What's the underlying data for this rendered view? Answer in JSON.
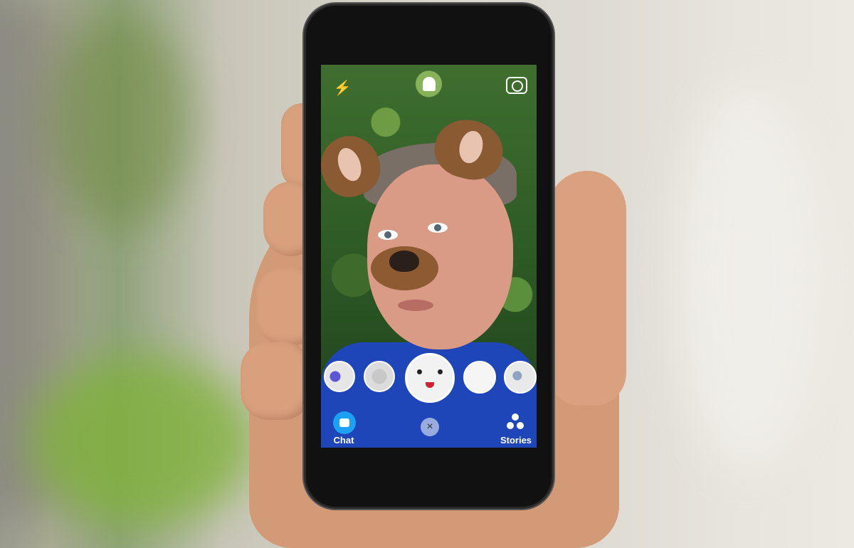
{
  "app": {
    "bottom_bar": {
      "chat_label": "Chat",
      "stories_label": "Stories"
    },
    "icons": {
      "flash": "flash-off-icon",
      "ghost": "ghost-icon",
      "flip_camera": "flip-camera-icon",
      "chat": "chat-bubble-icon",
      "close": "close-icon",
      "stories": "stories-icon"
    },
    "lenses": [
      "purple-glasses-lens",
      "glasses-lens",
      "dog-lens",
      "cute-face-lens",
      "character-lens"
    ],
    "colors": {
      "chat_accent": "#1ea0f3",
      "shirt": "#1e46b8"
    }
  }
}
